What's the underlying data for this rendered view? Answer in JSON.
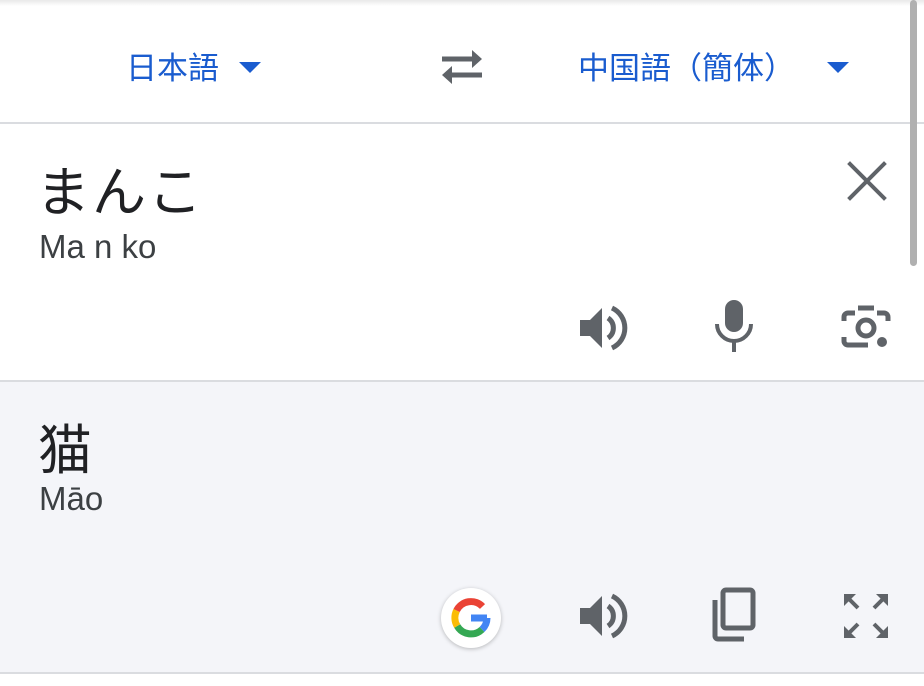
{
  "language_bar": {
    "source_language": "日本語",
    "target_language": "中国語（簡体）"
  },
  "source": {
    "text": "まんこ",
    "transliteration": "Ma n ko"
  },
  "target": {
    "text": "猫",
    "transliteration": "Māo"
  },
  "icons": {
    "swap": "swap-languages-icon",
    "clear": "close-icon",
    "source_speaker": "speaker-icon",
    "microphone": "microphone-icon",
    "camera": "camera-lens-icon",
    "google": "google-logo-icon",
    "target_speaker": "speaker-icon",
    "copy": "copy-icon",
    "fullscreen": "fullscreen-icon"
  },
  "colors": {
    "accent_blue": "#1a5ccf",
    "icon_gray": "#5f6368",
    "output_background": "#f4f5f9"
  }
}
